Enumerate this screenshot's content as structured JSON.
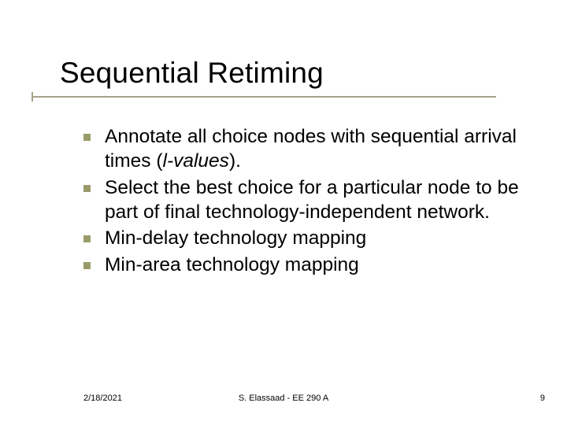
{
  "title": "Sequential Retiming",
  "bullets": [
    {
      "pre": "Annotate all choice nodes with sequential arrival times (",
      "em": "l-values",
      "post": ")."
    },
    {
      "pre": "Select the best choice for a particular node to be part of final technology-independent network.",
      "em": "",
      "post": ""
    },
    {
      "pre": "Min-delay technology mapping",
      "em": "",
      "post": ""
    },
    {
      "pre": "Min-area technology mapping",
      "em": "",
      "post": ""
    }
  ],
  "footer": {
    "date": "2/18/2021",
    "center": "S. Elassaad - EE 290 A",
    "page": "9"
  }
}
